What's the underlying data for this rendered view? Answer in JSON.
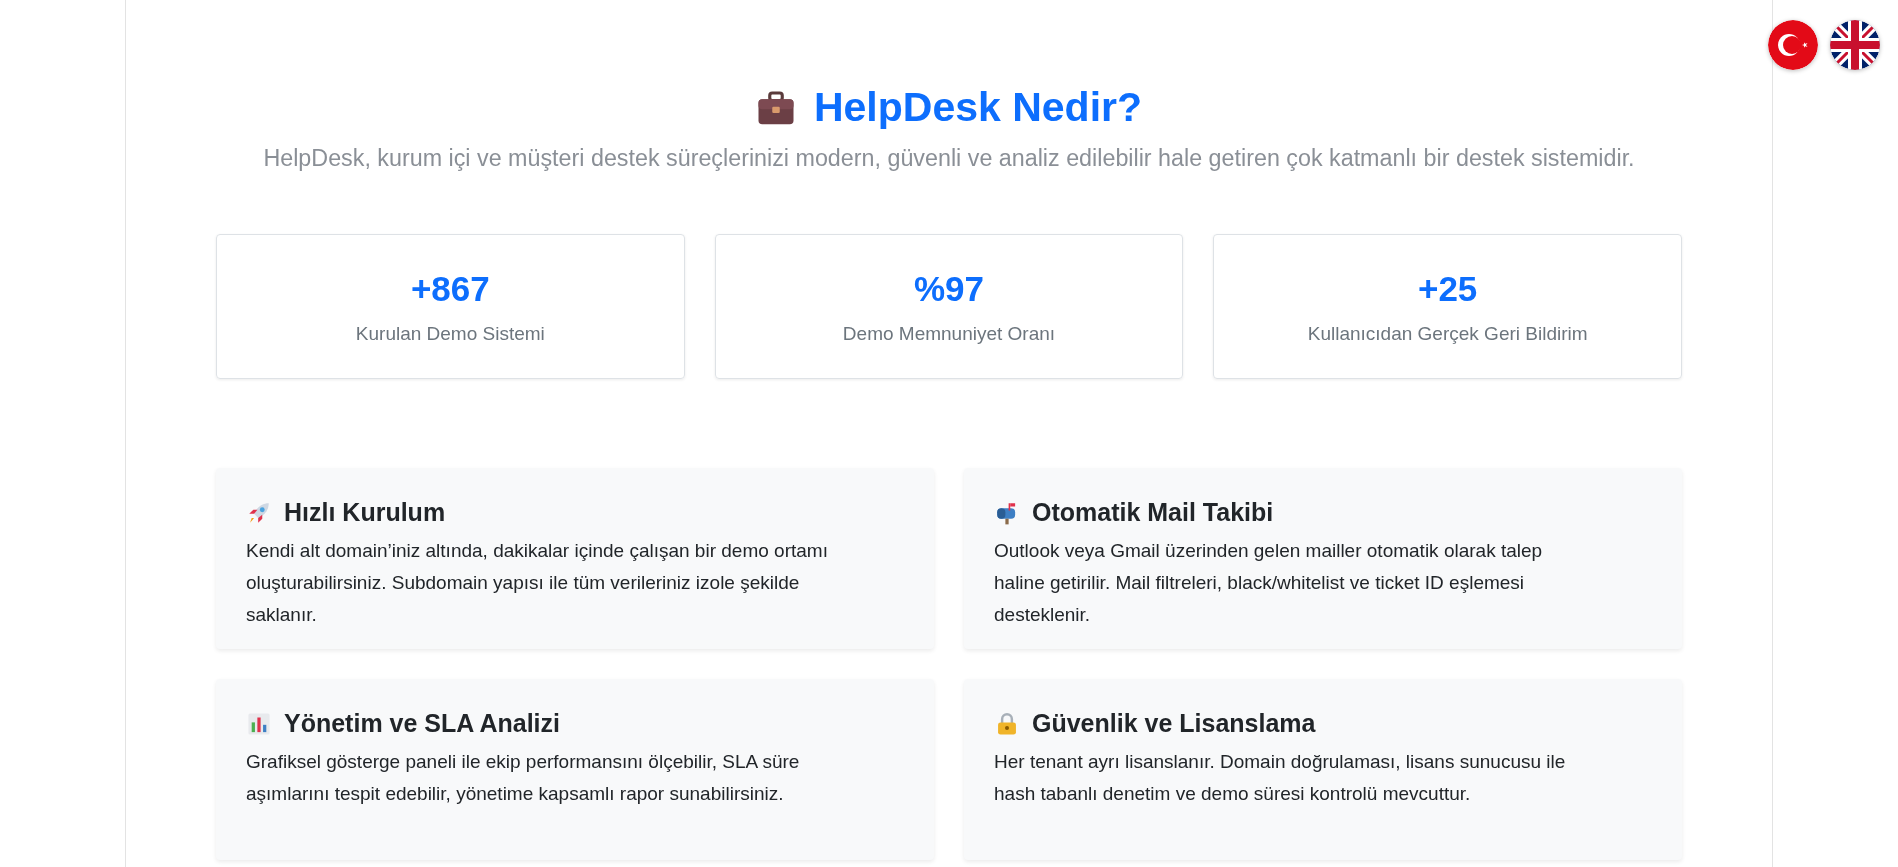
{
  "languages": [
    {
      "kind": "turkish"
    },
    {
      "kind": "english"
    }
  ],
  "hero": {
    "title": "HelpDesk Nedir?",
    "subtitle": "HelpDesk, kurum içi ve müşteri destek süreçlerinizi modern, güvenli ve analiz edilebilir hale getiren çok katmanlı bir destek sistemidir."
  },
  "stats": [
    {
      "value": "+867",
      "label": "Kurulan Demo Sistemi"
    },
    {
      "value": "%97",
      "label": "Demo Memnuniyet Oranı"
    },
    {
      "value": "+25",
      "label": "Kullanıcıdan Gerçek Geri Bildirim"
    }
  ],
  "features": [
    {
      "title": "Hızlı Kurulum",
      "text": "Kendi alt domain’iniz altında, dakikalar içinde çalışan bir demo ortamı oluşturabilirsiniz. Subdomain yapısı ile tüm verileriniz izole şekilde saklanır."
    },
    {
      "title": "Otomatik Mail Takibi",
      "text": "Outlook veya Gmail üzerinden gelen mailler otomatik olarak talep haline getirilir. Mail filtreleri, black/whitelist ve ticket ID eşlemesi desteklenir."
    },
    {
      "title": "Yönetim ve SLA Analizi",
      "text": "Grafiksel gösterge paneli ile ekip performansını ölçebilir, SLA süre aşımlarını tespit edebilir, yönetime kapsamlı rapor sunabilirsiniz."
    },
    {
      "title": "Güvenlik ve Lisanslama",
      "text": "Her tenant ayrı lisanslanır. Domain doğrulaması, lisans sunucusu ile hash tabanlı denetim ve demo süresi kontrolü mevcuttur."
    }
  ]
}
